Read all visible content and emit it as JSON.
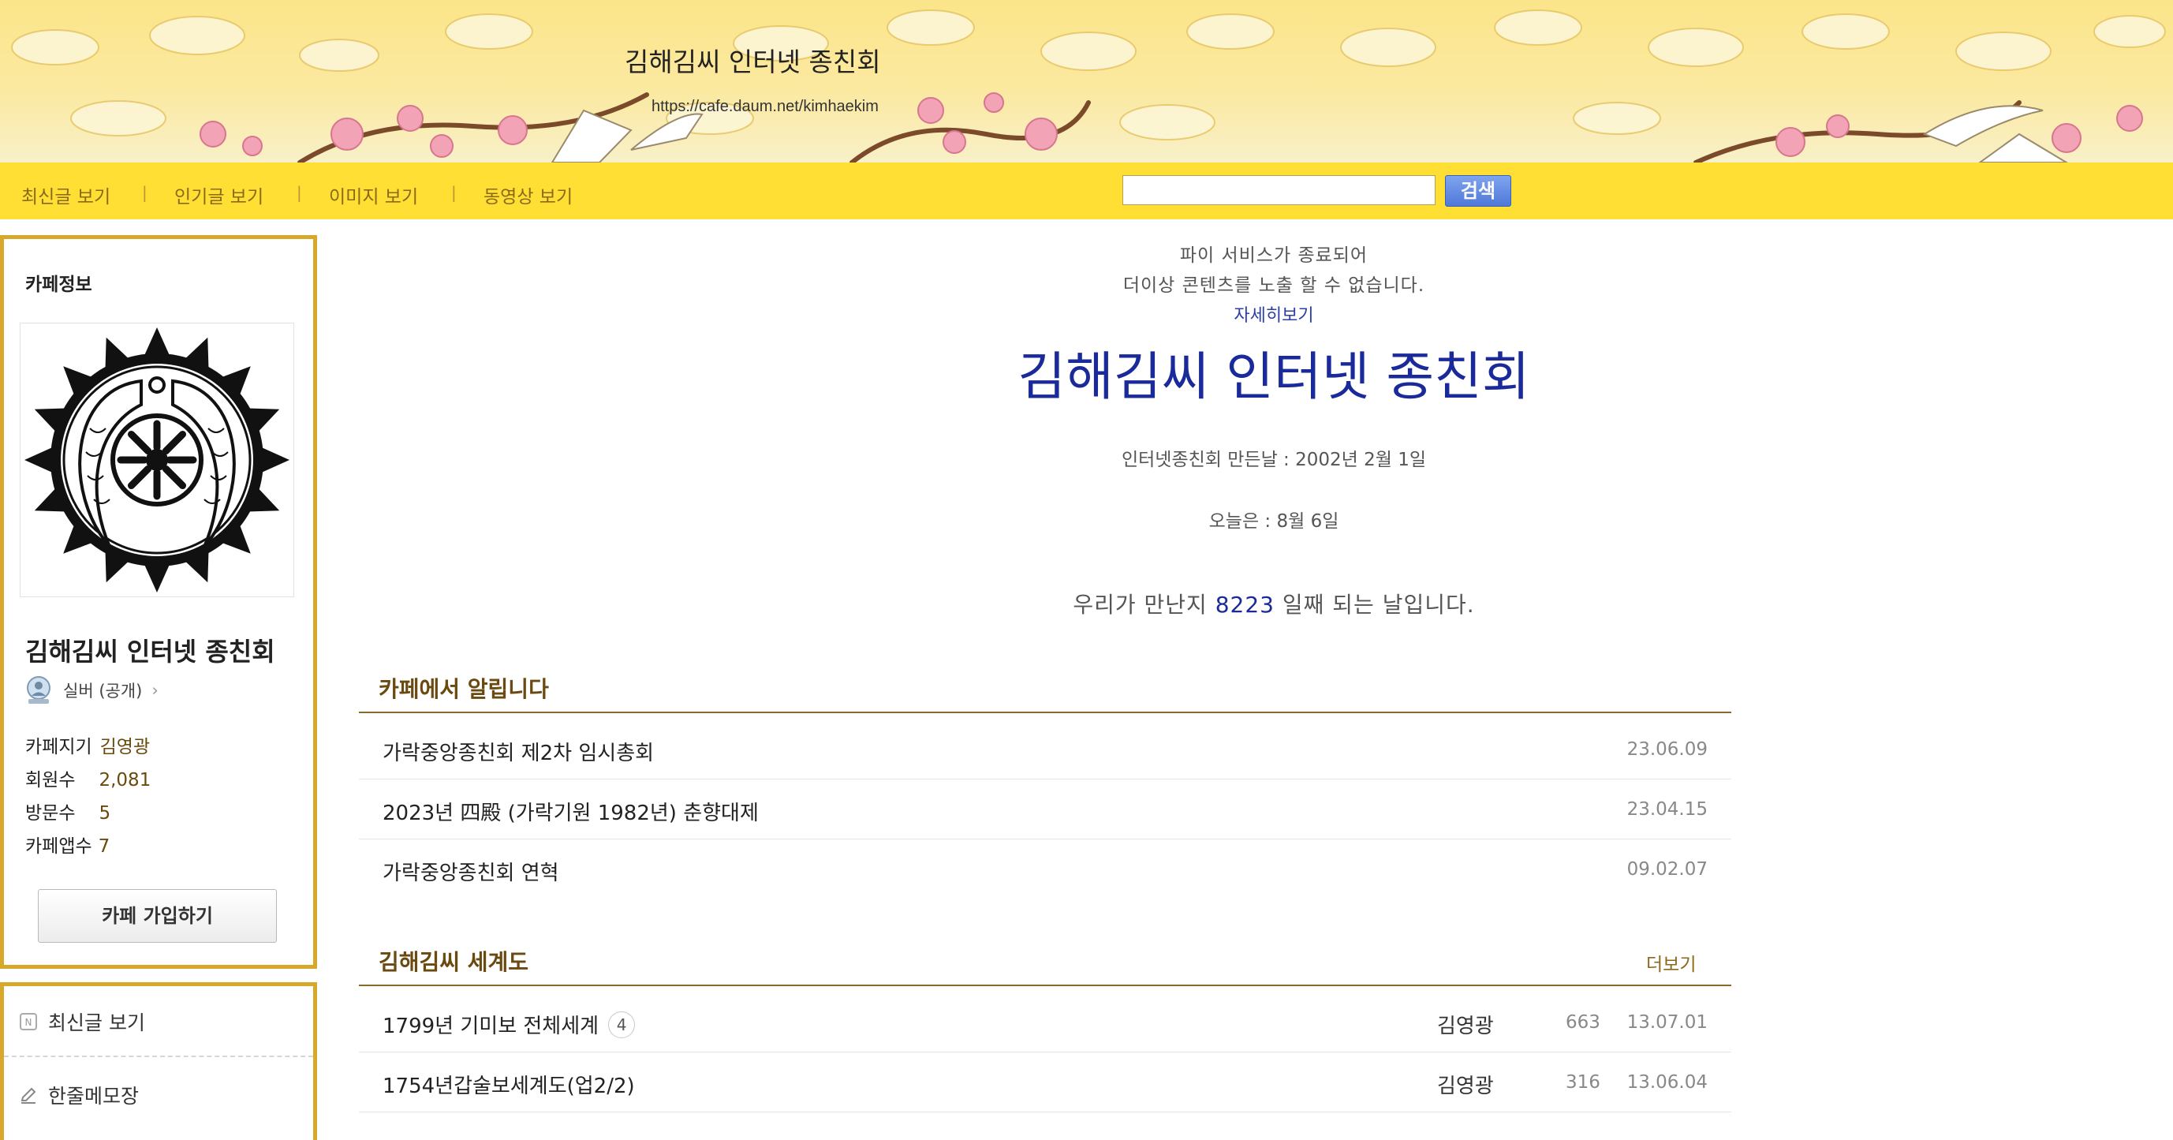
{
  "header": {
    "title": "김해김씨 인터넷 종친회",
    "url": "https://cafe.daum.net/kimhaekim"
  },
  "nav": {
    "items": [
      "최신글 보기",
      "인기글 보기",
      "이미지 보기",
      "동영상 보기"
    ],
    "separator": "|",
    "search_placeholder": "",
    "search_button": "검색"
  },
  "sidebar": {
    "heading": "카페정보",
    "cafe_name": "김해김씨 인터넷 종친회",
    "grade": "실버 (공개)",
    "stats": [
      {
        "label": "카페지기",
        "value": "김영광"
      },
      {
        "label": "회원수",
        "value": "2,081"
      },
      {
        "label": "방문수",
        "value": "5"
      },
      {
        "label": "카페앱수",
        "value": "7"
      }
    ],
    "join_button": "카페 가입하기",
    "menu": [
      "최신글 보기",
      "한줄메모장"
    ]
  },
  "main": {
    "notice_line1": "파이 서비스가 종료되어",
    "notice_line2": "더이상 콘텐츠를 노출 할 수 없습니다.",
    "detail_link": "자세히보기",
    "big_title": "김해김씨 인터넷 종친회",
    "founded": "인터넷종친회 만든날 : 2002년 2월 1일",
    "today": "오늘은 : 8월 6일",
    "days_prefix": "우리가 만난지",
    "days_count": "8223",
    "days_suffix": "일째 되는 날입니다."
  },
  "notices": {
    "title": "카페에서 알립니다",
    "rows": [
      {
        "title": "가락중앙종친회 제2차 임시총회",
        "date": "23.06.09"
      },
      {
        "title": "2023년 四殿 (가락기원 1982년) 춘향대제",
        "date": "23.04.15"
      },
      {
        "title": "가락중앙종친회 연혁",
        "date": "09.02.07"
      }
    ]
  },
  "genealogy": {
    "title": "김해김씨 세계도",
    "more": "더보기",
    "rows": [
      {
        "title": "1799년 기미보 전체세계",
        "comments": "4",
        "author": "김영광",
        "views": "663",
        "date": "13.07.01"
      },
      {
        "title": "1754년갑술보세계도(업2/2)",
        "comments": "",
        "author": "김영광",
        "views": "316",
        "date": "13.06.04"
      }
    ]
  },
  "colors": {
    "navbar": "#ffdf33",
    "sidebar_border": "#d8a82a",
    "title_blue": "#1a2a9a",
    "section_brown": "#6a4a10"
  }
}
